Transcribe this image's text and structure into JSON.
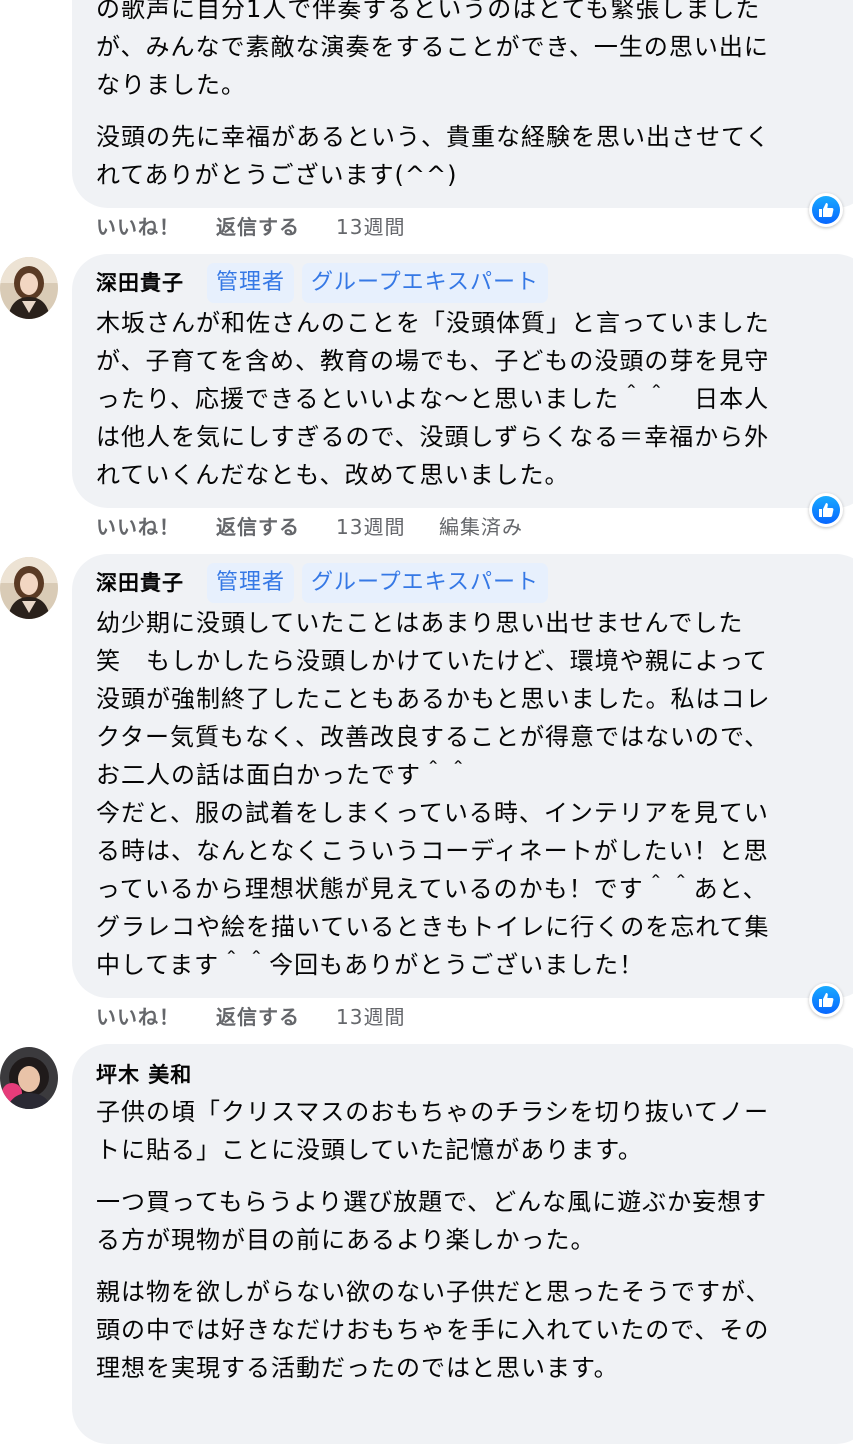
{
  "comments": [
    {
      "lines": [
        "の歌声に自分1人で伴奏するというのはとても緊張しました",
        "が、みんなで素敵な演奏をすることができ、一生の思い出に",
        "なりました。"
      ],
      "lines2": [
        "没頭の先に幸福があるという、貴重な経験を思い出させてく",
        "れてありがとうございます(^^)"
      ],
      "actions": {
        "like": "いいね！",
        "reply": "返信する",
        "time": "13週間"
      }
    },
    {
      "author": "深田貴子",
      "badges": [
        "管理者",
        "グループエキスパート"
      ],
      "lines": [
        "木坂さんが和佐さんのことを「没頭体質」と言っていました",
        "が、子育てを含め、教育の場でも、子どもの没頭の芽を見守",
        "ったり、応援できるといいよな〜と思いました＾＾　日本人",
        "は他人を気にしすぎるので、没頭しずらくなる＝幸福から外",
        "れていくんだなとも、改めて思いました。"
      ],
      "actions": {
        "like": "いいね！",
        "reply": "返信する",
        "time": "13週間",
        "edited": "編集済み"
      }
    },
    {
      "author": "深田貴子",
      "badges": [
        "管理者",
        "グループエキスパート"
      ],
      "lines": [
        "幼少期に没頭していたことはあまり思い出せませんでした",
        "笑　もしかしたら没頭しかけていたけど、環境や親によって",
        "没頭が強制終了したこともあるかもと思いました。私はコレ",
        "クター気質もなく、改善改良することが得意ではないので、",
        "お二人の話は面白かったです＾＾",
        "今だと、服の試着をしまくっている時、インテリアを見てい",
        "る時は、なんとなくこういうコーディネートがしたい！と思",
        "っているから理想状態が見えているのかも！です＾＾あと、",
        "グラレコや絵を描いているときもトイレに行くのを忘れて集",
        "中してます＾＾今回もありがとうございました！"
      ],
      "actions": {
        "like": "いいね！",
        "reply": "返信する",
        "time": "13週間"
      }
    },
    {
      "author": "坪木 美和",
      "lines": [
        "子供の頃「クリスマスのおもちゃのチラシを切り抜いてノー",
        "トに貼る」ことに没頭していた記憶があります。"
      ],
      "lines2": [
        "一つ買ってもらうより選び放題で、どんな風に遊ぶか妄想す",
        "る方が現物が目の前にあるより楽しかった。"
      ],
      "lines3": [
        "親は物を欲しがらない欲のない子供だと思ったそうですが、",
        "頭の中では好きなだけおもちゃを手に入れていたので、その",
        "理想を実現する活動だったのではと思います。"
      ]
    }
  ],
  "colors": {
    "bubble": "#f0f2f5",
    "badge_bg": "#e7f0fd",
    "badge_text": "#3578e5",
    "meta": "#65676b",
    "like": "#0866ff"
  }
}
